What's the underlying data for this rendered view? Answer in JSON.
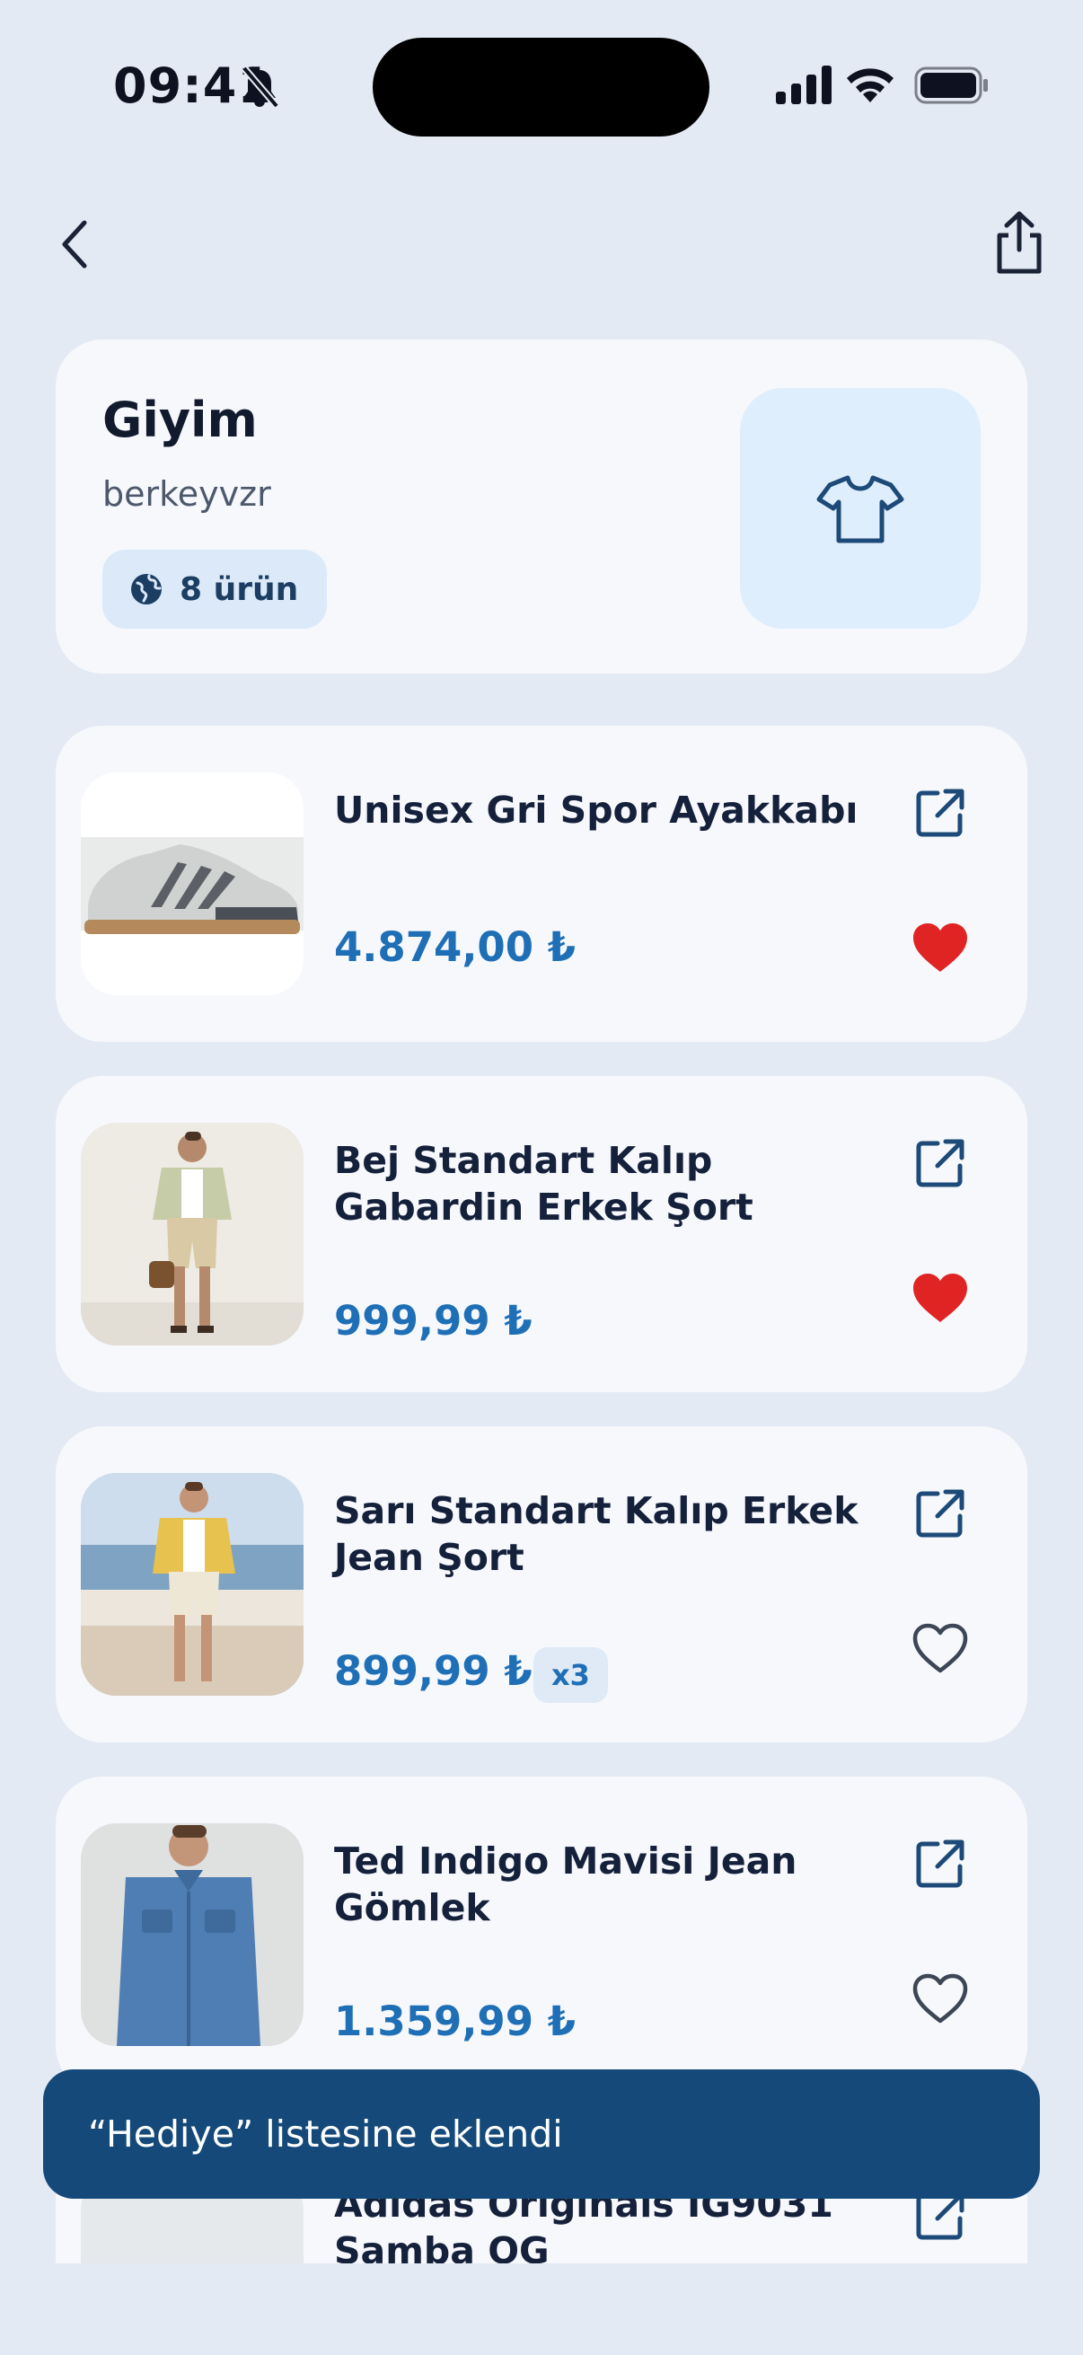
{
  "status_bar": {
    "time": "09:41",
    "accent_color": "#0e1220"
  },
  "header": {
    "title": "Giyim",
    "owner": "berkeyvzr",
    "item_count_label": "8 ürün",
    "visibility_icon": "globe-icon",
    "category_icon": "tshirt-icon"
  },
  "items": [
    {
      "name": "Unisex Gri Spor Ayakkabı",
      "price": "4.874,00 ₺",
      "quantity_badge": "",
      "favorited": true
    },
    {
      "name": "Bej Standart Kalıp Gabardin Erkek Şort",
      "price": "999,99 ₺",
      "quantity_badge": "",
      "favorited": true
    },
    {
      "name": "Sarı Standart Kalıp Erkek Jean Şort",
      "price": "899,99 ₺",
      "quantity_badge": "x3",
      "favorited": false
    },
    {
      "name": "Ted Indigo Mavisi Jean Gömlek",
      "price": "1.359,99 ₺",
      "quantity_badge": "",
      "favorited": false
    },
    {
      "name": "Adidas Originals IG9031 Samba OG",
      "price": "",
      "quantity_badge": "",
      "favorited": false
    }
  ],
  "toast": {
    "message": "“Hediye” listesine eklendi"
  },
  "colors": {
    "background": "#e4eaf3",
    "card": "#f6f8fc",
    "price": "#1f6fb6",
    "favorite": "#e02424",
    "toast": "#14497a"
  }
}
